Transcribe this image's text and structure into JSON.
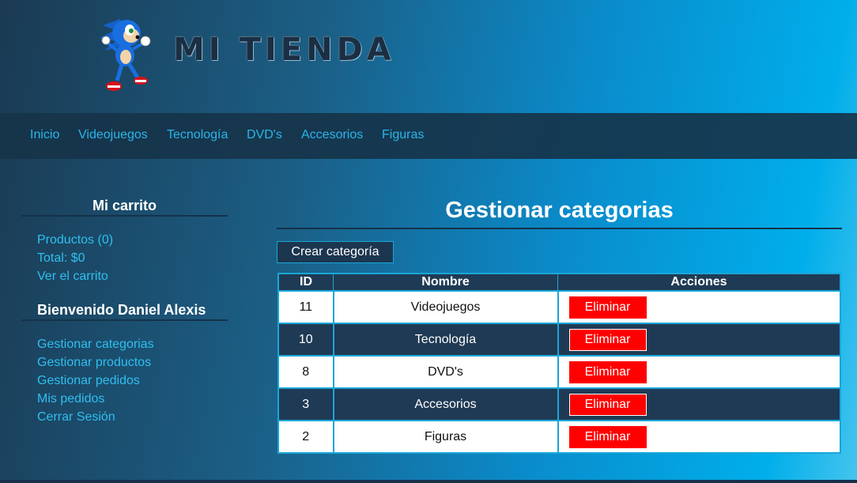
{
  "header": {
    "title": "MI TIENDA",
    "logo_icon": "sonic-mascot-icon"
  },
  "nav": {
    "items": [
      "Inicio",
      "Videojuegos",
      "Tecnología",
      "DVD's",
      "Accesorios",
      "Figuras"
    ]
  },
  "sidebar": {
    "cart_title": "Mi carrito",
    "cart_links": [
      "Productos (0)",
      "Total: $0",
      "Ver el carrito"
    ],
    "welcome": "Bienvenido Daniel Alexis",
    "user_links": [
      "Gestionar categorias",
      "Gestionar productos",
      "Gestionar pedidos",
      "Mis pedidos",
      "Cerrar Sesión"
    ]
  },
  "main": {
    "title": "Gestionar categorias",
    "create_button": "Crear categoría",
    "table": {
      "headers": [
        "ID",
        "Nombre",
        "Acciones"
      ],
      "rows": [
        {
          "id": "11",
          "name": "Videojuegos",
          "action": "Eliminar"
        },
        {
          "id": "10",
          "name": "Tecnología",
          "action": "Eliminar"
        },
        {
          "id": "8",
          "name": "DVD's",
          "action": "Eliminar"
        },
        {
          "id": "3",
          "name": "Accesorios",
          "action": "Eliminar"
        },
        {
          "id": "2",
          "name": "Figuras",
          "action": "Eliminar"
        }
      ]
    }
  },
  "colors": {
    "link": "#29b6ea",
    "danger": "#ff0000",
    "panel": "#1f3a54",
    "border": "#1aa6d8"
  }
}
